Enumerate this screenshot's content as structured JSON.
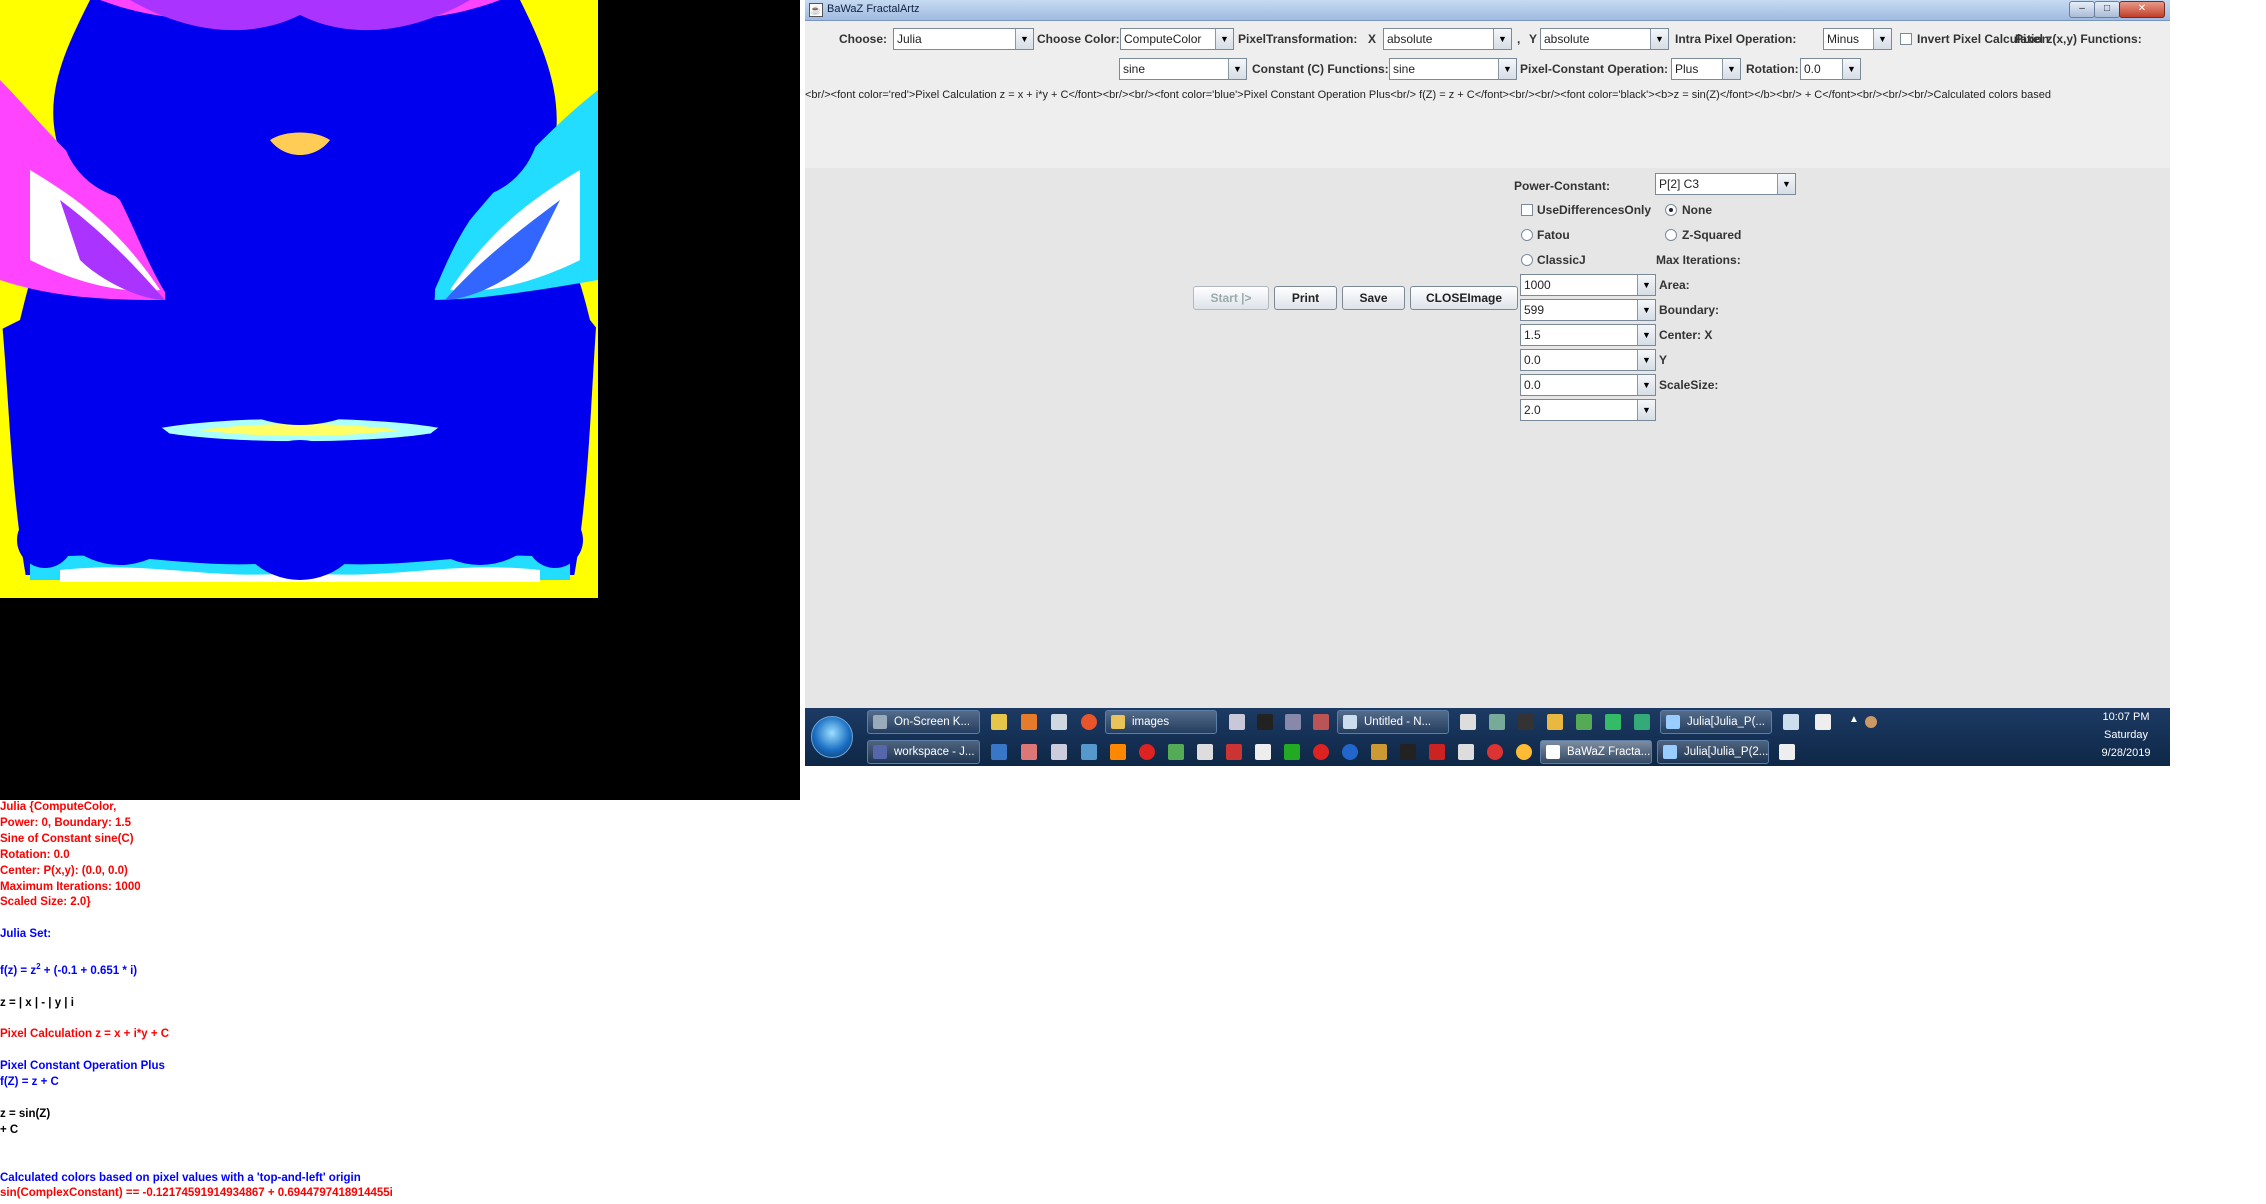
{
  "window": {
    "title": "BaWaZ FractalArtz",
    "minimize": "–",
    "maximize": "□",
    "close": "✕"
  },
  "toolbar": {
    "choose_label": "Choose:",
    "choose_value": "Julia",
    "choose_color_label": "Choose Color:",
    "choose_color_value": "ComputeColor",
    "pixel_transform_label": "PixelTransformation:",
    "x_label": "X",
    "x_value": "absolute",
    "comma": ",",
    "y_label": "Y",
    "y_value": "absolute",
    "intra_pixel_label": "Intra Pixel Operation:",
    "intra_pixel_value": "Minus",
    "invert_label": "Invert Pixel Calculation",
    "pixel_functions_label": "Pixel z(x,y) Functions:",
    "pixel_function_value": "sine",
    "constant_functions_label": "Constant (C) Functions:",
    "constant_function_value": "sine",
    "pixel_constant_op_label": "Pixel-Constant Operation:",
    "pixel_constant_op_value": "Plus",
    "rotation_label": "Rotation:",
    "rotation_value": "0.0"
  },
  "html_source": "<br/><font color='red'>Pixel Calculation z = x + i*y + C</font><br/><br/><font color='blue'>Pixel Constant Operation Plus<br/>   f(Z) = z + C</font><br/><br/><font color='black'><b>z = sin(Z)</font></b><br/> + C</font><br/><br/><br/>Calculated colors based",
  "controls": {
    "power_constant_label": "Power-Constant:",
    "power_constant_value": "P[2] C3",
    "use_differences_label": "UseDifferencesOnly",
    "none_label": "None",
    "fatou_label": "Fatou",
    "z_squared_label": "Z-Squared",
    "classicj_label": "ClassicJ",
    "max_iterations_label": "Max Iterations:",
    "area_label": "Area:",
    "boundary_label": "Boundary:",
    "center_x_label": "Center: X",
    "y_label": "Y",
    "scale_size_label": "ScaleSize:",
    "fields": [
      "1000",
      "599",
      "1.5",
      "0.0",
      "0.0",
      "2.0"
    ]
  },
  "buttons": {
    "start": "Start |>",
    "print": "Print",
    "save": "Save",
    "close_image": "CLOSEImage"
  },
  "taskbar": {
    "row1": [
      "On-Screen K...",
      "images",
      "Untitled - N...",
      "Julia[Julia_P(..."
    ],
    "row2": [
      "workspace - J...",
      "BaWaZ Fracta...",
      "Julia[Julia_P(2..."
    ],
    "show_hidden": "▲",
    "clock": {
      "time": "10:07 PM",
      "day": "Saturday",
      "date": "9/28/2019"
    }
  },
  "info": {
    "lines_red_1": [
      "Julia {ComputeColor,",
      "Power: 0, Boundary: 1.5",
      "Sine of Constant sine(C)",
      "Rotation: 0.0",
      "Center: P(x,y): (0.0, 0.0)",
      "Maximum Iterations: 1000",
      "Scaled Size: 2.0}"
    ],
    "julia_set": "Julia Set:",
    "formula_prefix": "f(z) = z",
    "formula_exp": "2",
    "formula_suffix": " + (-0.1 + 0.651 * i)",
    "abs_line": "z = | x | - | y | i",
    "pixel_calc": "Pixel Calculation z = x + i*y + C",
    "pco_line1": "Pixel Constant Operation Plus",
    "pco_line2": "f(Z) = z + C",
    "sin_line1": "z = sin(Z)",
    "sin_line2": "+ C",
    "calc_colors": "Calculated colors based on pixel values with a 'top-and-left' origin",
    "sin_constant": "sin(ComplexConstant) == -0.12174591914934867 + 0.6944797418914455i"
  },
  "colors": {
    "fractal_blue": "#0000ee",
    "info_red": "#ff0000",
    "info_blue": "#0000ff"
  }
}
